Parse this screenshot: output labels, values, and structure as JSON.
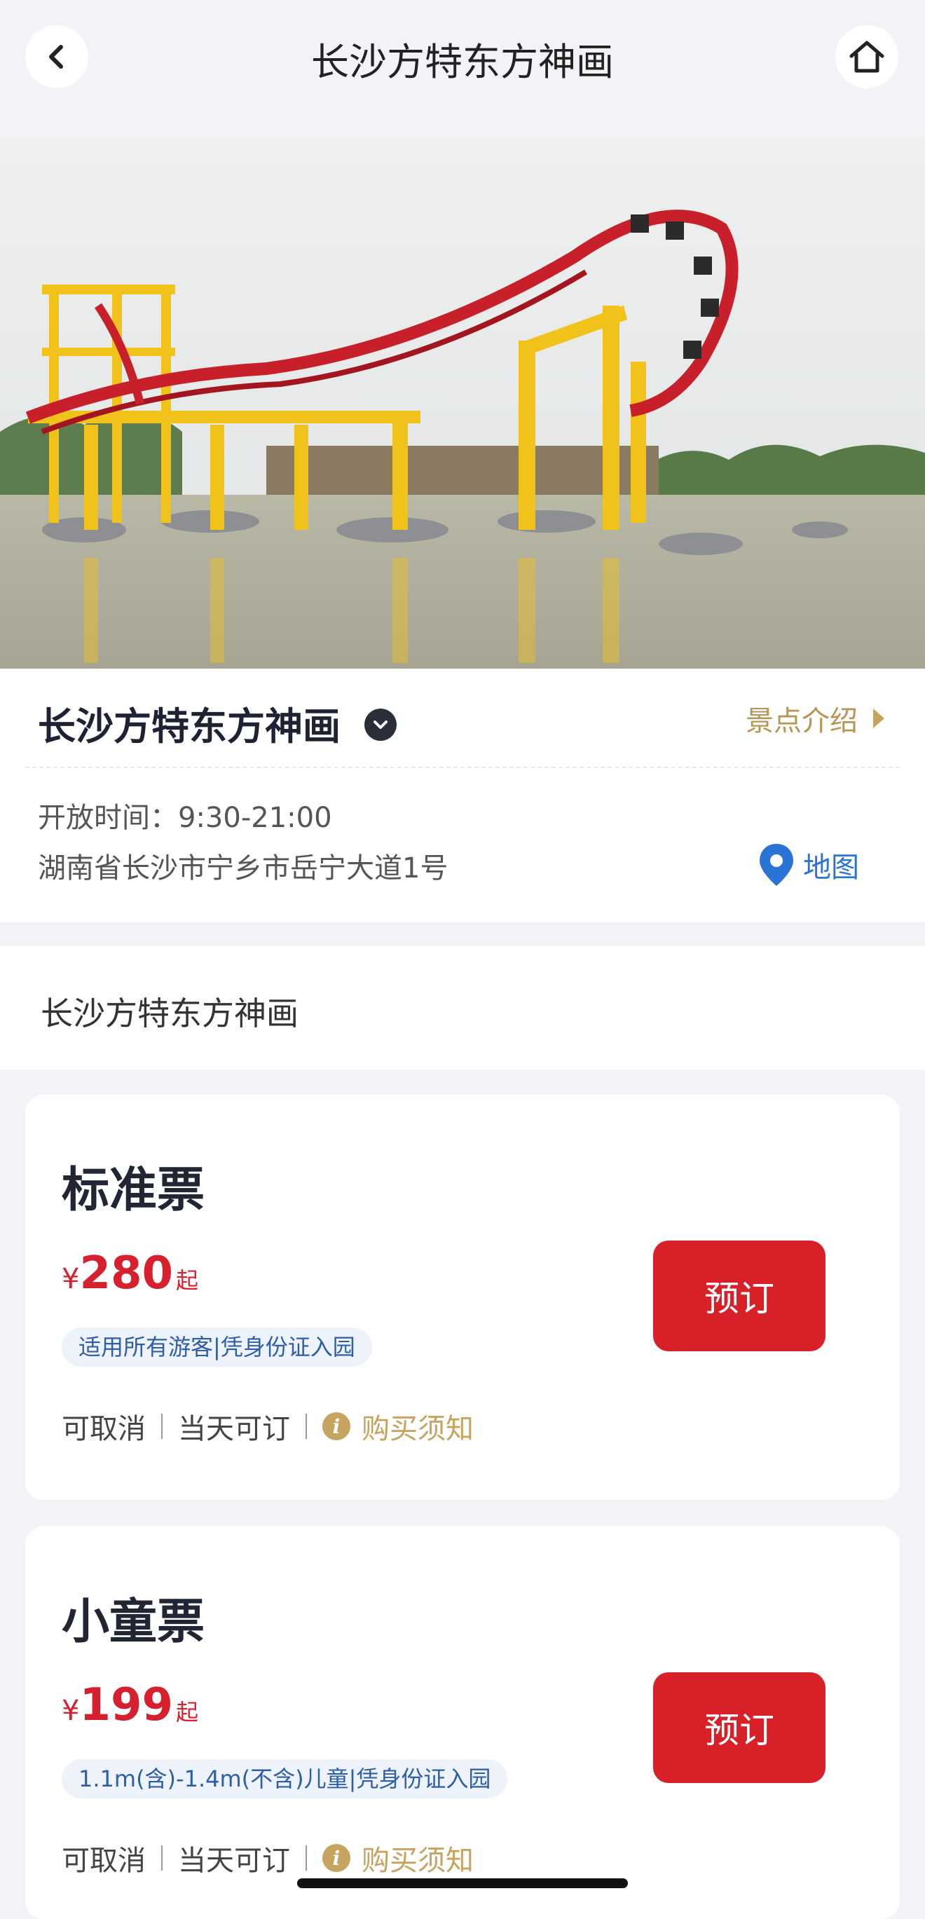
{
  "header": {
    "title": "长沙方特东方神画",
    "back_icon": "chevron-left-icon",
    "home_icon": "home-icon"
  },
  "hero": {
    "image": "roller-coaster-over-lake-photo"
  },
  "info": {
    "title": "长沙方特东方神画",
    "intro_link": "景点介绍",
    "open_time": "开放时间：9:30-21:00",
    "address": "湖南省长沙市宁乡市岳宁大道1号",
    "map_label": "地图"
  },
  "section": {
    "name": "长沙方特东方神画"
  },
  "tickets": [
    {
      "name": "标准票",
      "currency": "¥",
      "price": "280",
      "price_suffix": "起",
      "tag": "适用所有游客|凭身份证入园",
      "book_label": "预订",
      "cancel": "可取消",
      "same_day": "当天可订",
      "notice": "购买须知"
    },
    {
      "name": "小童票",
      "currency": "¥",
      "price": "199",
      "price_suffix": "起",
      "tag": "1.1m(含)-1.4m(不含)儿童|凭身份证入园",
      "book_label": "预订",
      "cancel": "可取消",
      "same_day": "当天可订",
      "notice": "购买须知"
    }
  ],
  "colors": {
    "accent_red": "#d82029",
    "gold": "#c6a35e",
    "link_blue": "#2a74d6",
    "background": "#f2f3f6"
  }
}
